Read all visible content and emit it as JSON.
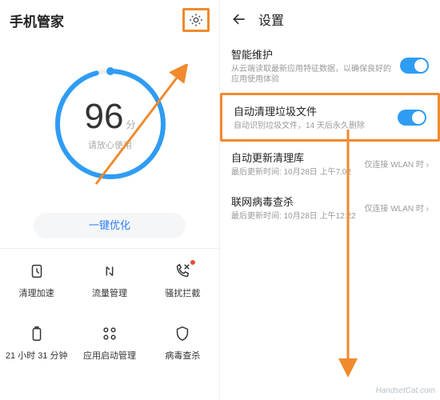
{
  "left": {
    "title": "手机管家",
    "score": "96",
    "score_unit": "分",
    "score_hint": "请放心使用",
    "optimize_label": "一键优化",
    "grid": [
      {
        "label": "清理加速"
      },
      {
        "label": "流量管理"
      },
      {
        "label": "骚扰拦截"
      },
      {
        "label": "21 小时 31 分钟"
      },
      {
        "label": "应用启动管理"
      },
      {
        "label": "病毒查杀"
      }
    ]
  },
  "right": {
    "title": "设置",
    "items": [
      {
        "title": "智能维护",
        "desc": "从云端读取最新应用特征数据，以确保良好的应用使用体验",
        "toggle": true
      },
      {
        "title": "自动清理垃圾文件",
        "desc": "自动识别垃圾文件，14 天后永久删除",
        "toggle": true,
        "highlight": true
      },
      {
        "title": "自动更新清理库",
        "desc": "最后更新时间: 10月28日 上午7:02",
        "meta": "仅连接 WLAN 时 ›"
      },
      {
        "title": "联网病毒查杀",
        "desc": "最后更新时间: 10月28日 上午12:22",
        "meta": "仅连接 WLAN 时 ›"
      }
    ]
  },
  "credit": "HandsetCat.com"
}
